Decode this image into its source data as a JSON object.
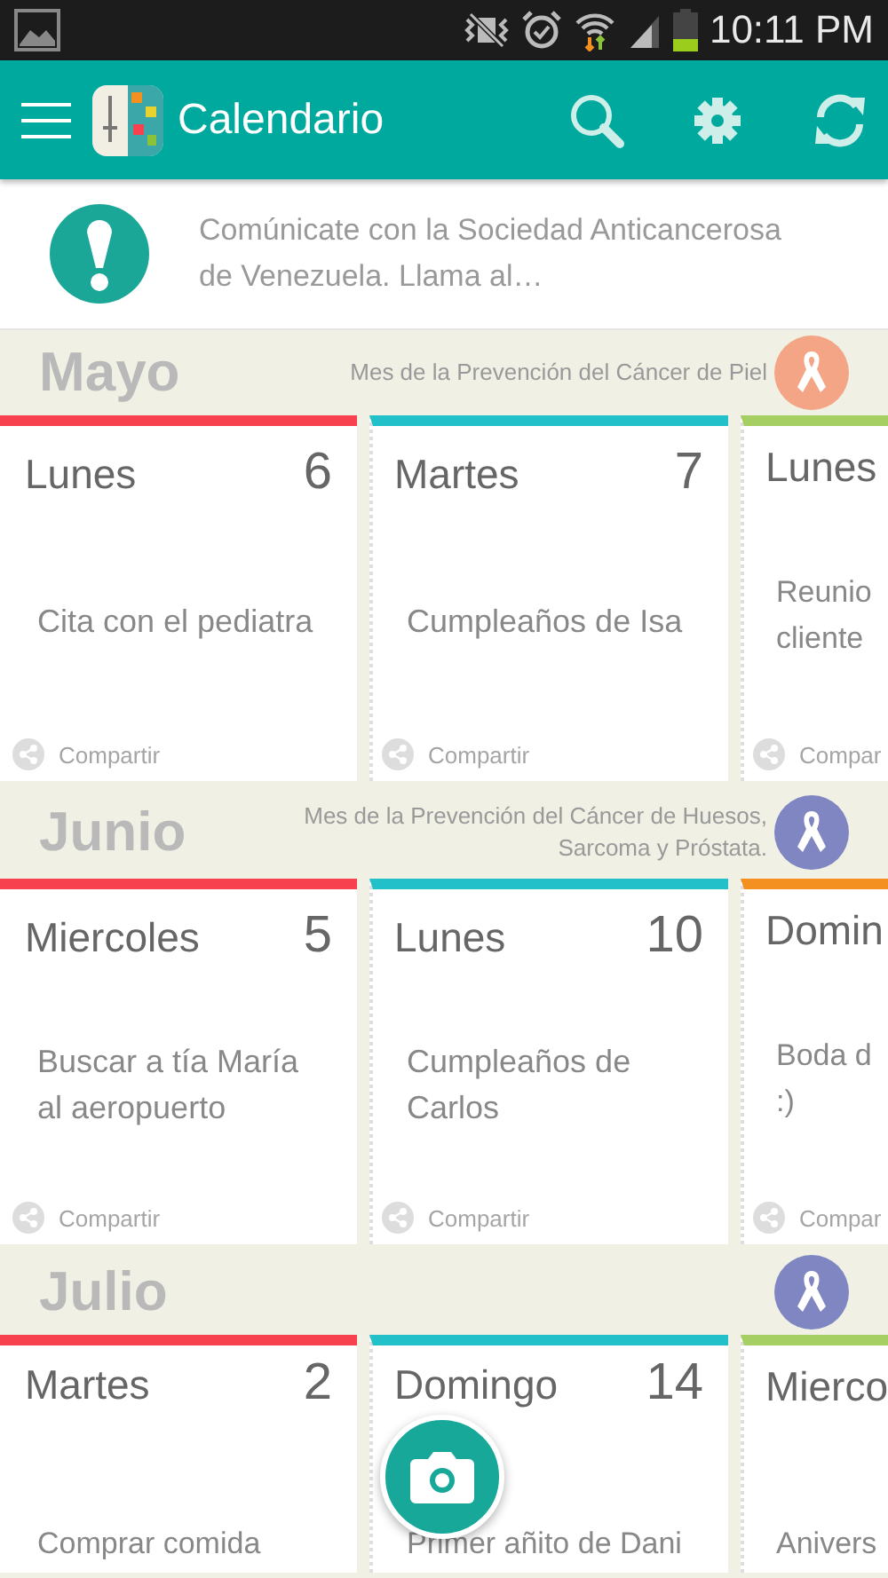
{
  "status_bar": {
    "time": "10:11 PM"
  },
  "app_bar": {
    "title": "Calendario"
  },
  "notice": {
    "text": "Comúnicate con la Sociedad Anticancerosa de Venezuela. Llama al…"
  },
  "months": [
    {
      "name": "Mayo",
      "campaign": "Mes de la Prevención del Cáncer de Piel",
      "color": "#f4a585",
      "cards": [
        {
          "day": "Lunes",
          "date": "6",
          "event": "Cita con el pediatra",
          "share": "Compartir",
          "color": "#f7414e"
        },
        {
          "day": "Martes",
          "date": "7",
          "event": "Cumpleaños de Isa",
          "share": "Compartir",
          "color": "#22c0c8"
        },
        {
          "day": "Lunes",
          "event": "Reunio\ncliente",
          "share": "Compar",
          "color": "#a5cf63"
        }
      ]
    },
    {
      "name": "Junio",
      "campaign": "Mes de la Prevención del Cáncer de Huesos, Sarcoma y Próstata.",
      "color": "#7f86c2",
      "cards": [
        {
          "day": "Miercoles",
          "date": "5",
          "event": "Buscar a tía María al aeropuerto",
          "share": "Compartir",
          "color": "#f7414e"
        },
        {
          "day": "Lunes",
          "date": "10",
          "event": "Cumpleaños de Carlos",
          "share": "Compartir",
          "color": "#22c0c8"
        },
        {
          "day": "Domin",
          "event": "Boda d\n:)",
          "share": "Compar",
          "color": "#f39020"
        }
      ]
    },
    {
      "name": "Julio",
      "color": "#7f86c2",
      "cards": [
        {
          "day": "Martes",
          "date": "2",
          "event": "Comprar comida",
          "color": "#f7414e"
        },
        {
          "day": "Domingo",
          "date": "14",
          "event": "Primer añito de Dani",
          "color": "#22c0c8"
        },
        {
          "day": "Mierco",
          "event": "Anivers",
          "color": "#a5cf63"
        }
      ]
    }
  ]
}
